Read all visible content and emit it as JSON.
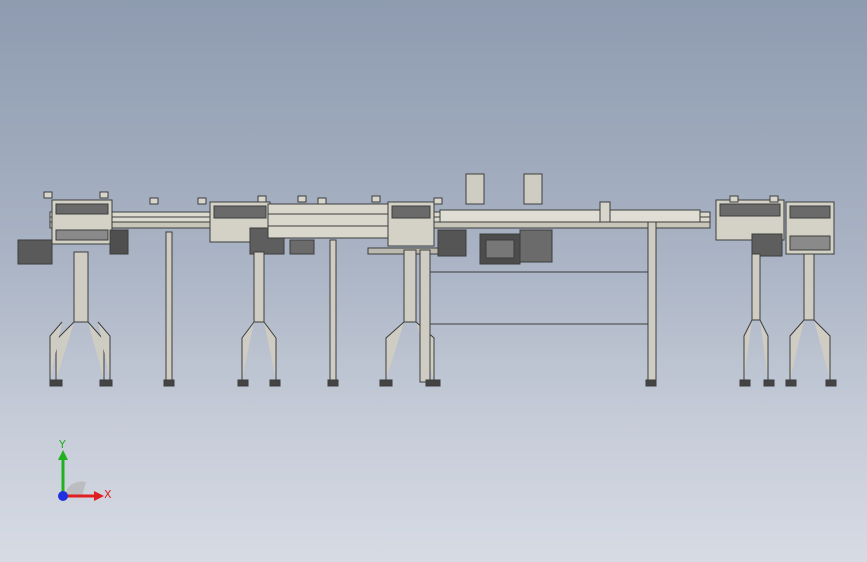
{
  "viewport": {
    "background_top": "#8e9bb0",
    "background_bottom": "#d6dbe4"
  },
  "model": {
    "line_color": "#3d3d3d",
    "metal_fill": "#d4d2c6",
    "dark_fill": "#5a5a5a",
    "motor_fill": "#6b6b6b"
  },
  "triad": {
    "x_label": "X",
    "y_label": "Y",
    "x_color": "#e02020",
    "y_color": "#20b020",
    "z_color": "#2030e0"
  }
}
